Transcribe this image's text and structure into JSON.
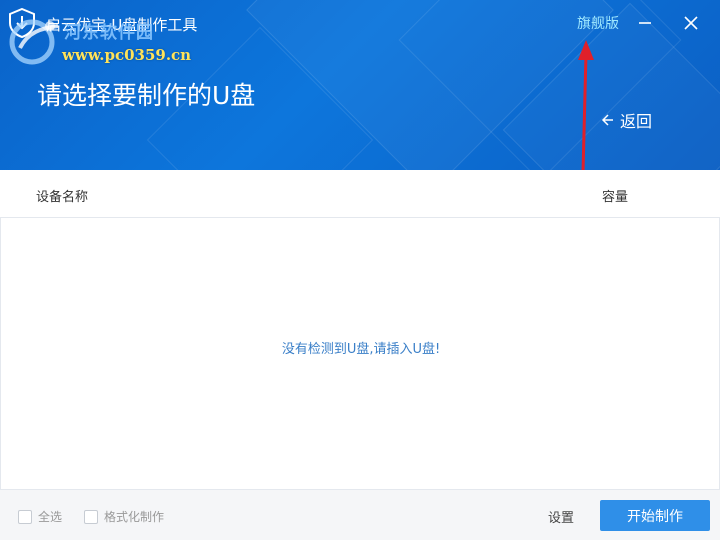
{
  "window": {
    "title": "启云优宝-U盘制作工具",
    "flagship_label": "旗舰版"
  },
  "watermark": {
    "site_name": "河东软件园",
    "url": "www.pc0359.cn"
  },
  "header": {
    "page_title": "请选择要制作的U盘",
    "back_label": "返回"
  },
  "table": {
    "columns": [
      "设备名称",
      "容量"
    ],
    "empty_message": "没有检测到U盘,请插入U盘!"
  },
  "footer": {
    "select_all_label": "全选",
    "format_label": "格式化制作",
    "select_all_checked": false,
    "format_checked": false,
    "settings_label": "设置",
    "start_button_label": "开始制作"
  },
  "colors": {
    "header_blue": "#0d76dc",
    "flagship_text": "#9fe8ff",
    "empty_text": "#3a7fc8",
    "primary_button": "#2f8fe8",
    "annotation_arrow": "#e0202a",
    "watermark_url": "#ffe35a"
  },
  "icons": {
    "app_logo": "shield-logo-icon",
    "minimize": "minimize-icon",
    "close": "close-icon",
    "back": "arrow-left-icon"
  }
}
